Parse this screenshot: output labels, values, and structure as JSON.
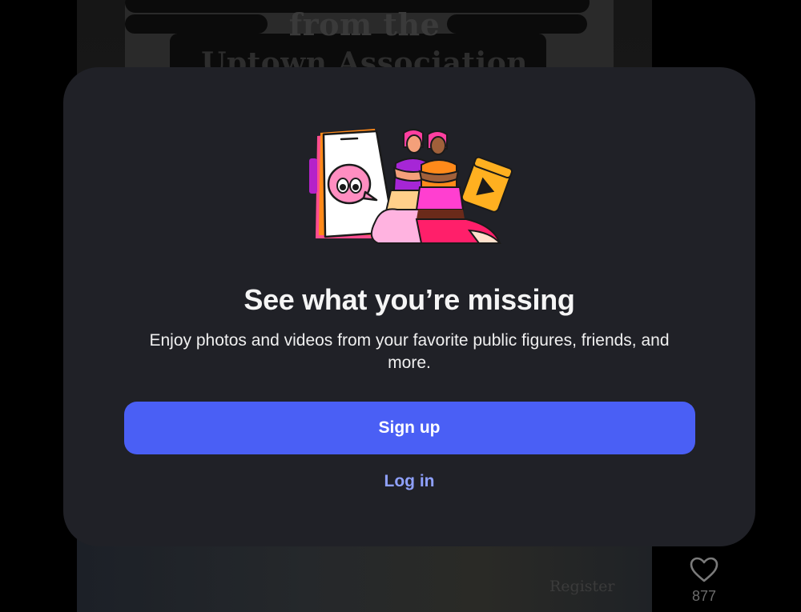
{
  "background_post": {
    "headline_line1": "from the",
    "headline_line2": "Uptown Association",
    "register_text": "Register",
    "like_count": "877",
    "heart_icon": "heart-icon"
  },
  "modal": {
    "illustration_icon": "people-phone-chat-illustration",
    "title": "See what you’re missing",
    "subtitle": "Enjoy photos and videos from your favorite public figures, friends, and more.",
    "signup_label": "Sign up",
    "login_label": "Log in",
    "colors": {
      "background": "#202127",
      "primary_button": "#4a5ff5",
      "link": "#8fa1ff"
    }
  }
}
